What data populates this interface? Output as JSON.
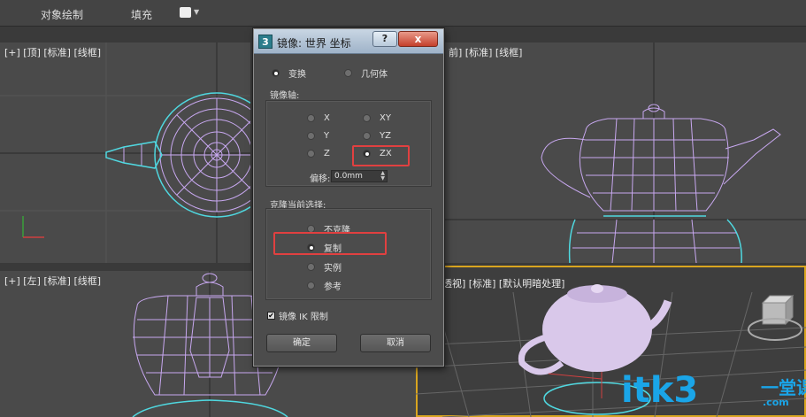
{
  "ribbon": {
    "tab1": "对象绘制",
    "tab2": "填充"
  },
  "viewports": {
    "top_left": "[+] [顶] [标准] [线框]",
    "top_right": "前] [标准] [线框]",
    "bottom_left": "[+] [左] [标准] [线框]",
    "bottom_right": "透视] [标准] [默认明暗处理]"
  },
  "dialog": {
    "app_icon": "3",
    "title": "镜像: 世界 坐标",
    "help": "?",
    "close": "x",
    "mode_transform": "变换",
    "mode_geometry": "几何体",
    "axis_group_title": "镜像轴:",
    "axis_x": "X",
    "axis_y": "Y",
    "axis_z": "Z",
    "axis_xy": "XY",
    "axis_yz": "YZ",
    "axis_zx": "ZX",
    "offset_label": "偏移:",
    "offset_value": "0.0mm",
    "clone_group_title": "克隆当前选择:",
    "clone_none": "不克隆",
    "clone_copy": "复制",
    "clone_instance": "实例",
    "clone_reference": "参考",
    "mirror_ik_label": "镜像 IK 限制",
    "ok_label": "确定",
    "cancel_label": "取消",
    "selected_mode": "transform",
    "selected_axis": "ZX",
    "selected_clone": "copy"
  },
  "watermark": {
    "latin": "itk3",
    "cjk": "一堂课",
    "sub": ".com"
  },
  "colors": {
    "wireframe": "#c8a8f0",
    "selection": "#4fd8e0",
    "highlight_box": "#e14040",
    "watermark": "#1aa5e8"
  }
}
